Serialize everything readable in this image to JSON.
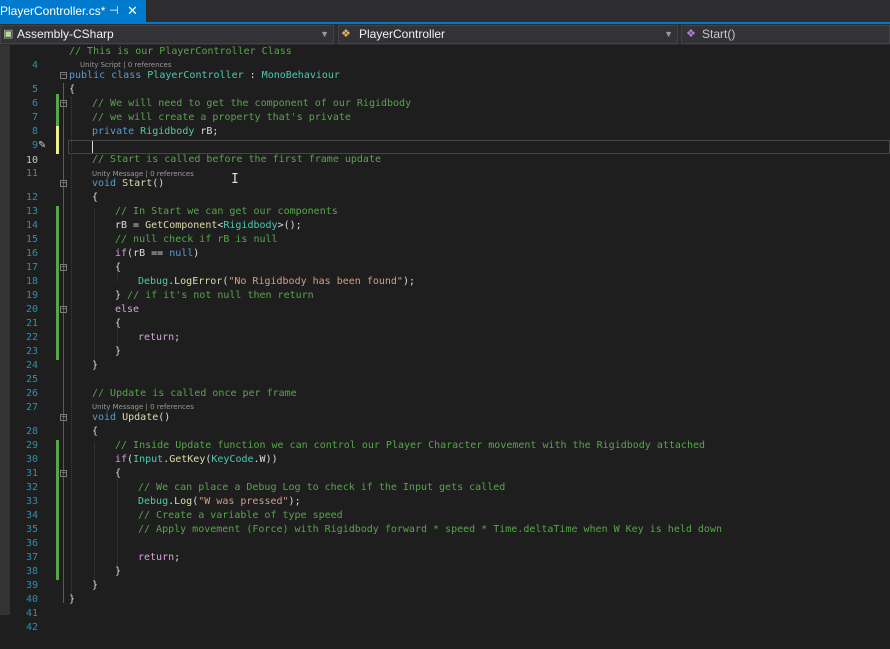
{
  "tab": {
    "title": "PlayerController.cs*",
    "pin": "⊣",
    "close": "✕"
  },
  "nav": {
    "project": "Assembly-CSharp",
    "class": "PlayerController",
    "member": "Start()",
    "project_icon": "csharp-project-icon",
    "class_icon": "class-icon",
    "member_icon": "method-icon"
  },
  "lens": {
    "unity_script": "Unity Script | 0 references",
    "unity_message": "Unity Message | 0 references"
  },
  "colors": {
    "accent": "#007acc",
    "comment": "#57a64a",
    "keyword": "#569cd6",
    "type": "#4ec9b0",
    "string": "#d69d85",
    "method": "#dcdcaa",
    "control": "#d8a0df"
  },
  "lines": [
    {
      "num": "4"
    },
    {
      "num": "5"
    },
    {
      "num": "6"
    },
    {
      "num": "7"
    },
    {
      "num": "8"
    },
    {
      "num": "9"
    },
    {
      "num": "10"
    },
    {
      "num": "11"
    },
    {
      "num": "12"
    },
    {
      "num": "13"
    },
    {
      "num": "14"
    },
    {
      "num": "15"
    },
    {
      "num": "16"
    },
    {
      "num": "17"
    },
    {
      "num": "18"
    },
    {
      "num": "19"
    },
    {
      "num": "20"
    },
    {
      "num": "21"
    },
    {
      "num": "22"
    },
    {
      "num": "23"
    },
    {
      "num": "24"
    },
    {
      "num": "25"
    },
    {
      "num": "26"
    },
    {
      "num": "27"
    },
    {
      "num": "28"
    },
    {
      "num": "29"
    },
    {
      "num": "30"
    },
    {
      "num": "31"
    },
    {
      "num": "32"
    },
    {
      "num": "33"
    },
    {
      "num": "34"
    },
    {
      "num": "35"
    },
    {
      "num": "36"
    },
    {
      "num": "37"
    },
    {
      "num": "38"
    },
    {
      "num": "39"
    },
    {
      "num": "40"
    },
    {
      "num": "41"
    },
    {
      "num": "42"
    }
  ],
  "code": {
    "l4": "// This is our PlayerController Class",
    "l5a": "public class ",
    "l5b": "PlayerController",
    "l5c": " : ",
    "l5d": "MonoBehaviour",
    "l6": "{",
    "l7": "// We will need to get the component of our Rigidbody",
    "l8": "// we will create a property that's private",
    "l9a": "private ",
    "l9b": "Rigidbody",
    "l9c": " rB;",
    "l11": "// Start is called before the first frame update",
    "l12a": "void ",
    "l12b": "Start",
    "l12c": "()",
    "l13": "{",
    "l14": "// In Start we can get our components",
    "l15a": "rB = ",
    "l15b": "GetComponent",
    "l15c": "<",
    "l15d": "Rigidbody",
    "l15e": ">();",
    "l16": "// null check if rB is null",
    "l17a": "if",
    "l17b": "(rB == ",
    "l17c": "null",
    "l17d": ")",
    "l18": "{",
    "l19a": "Debug",
    "l19b": ".",
    "l19c": "LogError",
    "l19d": "(",
    "l19e": "\"No Rigidbody has been found\"",
    "l19f": ");",
    "l20a": "} ",
    "l20b": "// if it's not null then return",
    "l21": "else",
    "l22": "{",
    "l23a": "return",
    "l23b": ";",
    "l24": "}",
    "l25": "}",
    "l27": "// Update is called once per frame",
    "l28a": "void ",
    "l28b": "Update",
    "l28c": "()",
    "l29": "{",
    "l30": "// Inside Update function we can control our Player Character movement with the Rigidbody attached",
    "l31a": "if",
    "l31b": "(",
    "l31c": "Input",
    "l31d": ".",
    "l31e": "GetKey",
    "l31f": "(",
    "l31g": "KeyCode",
    "l31h": ".W))",
    "l32": "{",
    "l33": "// We can place a Debug Log to check if the Input gets called",
    "l34a": "Debug",
    "l34b": ".",
    "l34c": "Log",
    "l34d": "(",
    "l34e": "\"W was pressed\"",
    "l34f": ");",
    "l35": "// Create a variable of type speed",
    "l36": "// Apply movement (Force) with Rigidbody forward * speed * Time.deltaTime when W Key is held down",
    "l38a": "return",
    "l38b": ";",
    "l39": "}",
    "l40": "}",
    "l41": "}"
  }
}
